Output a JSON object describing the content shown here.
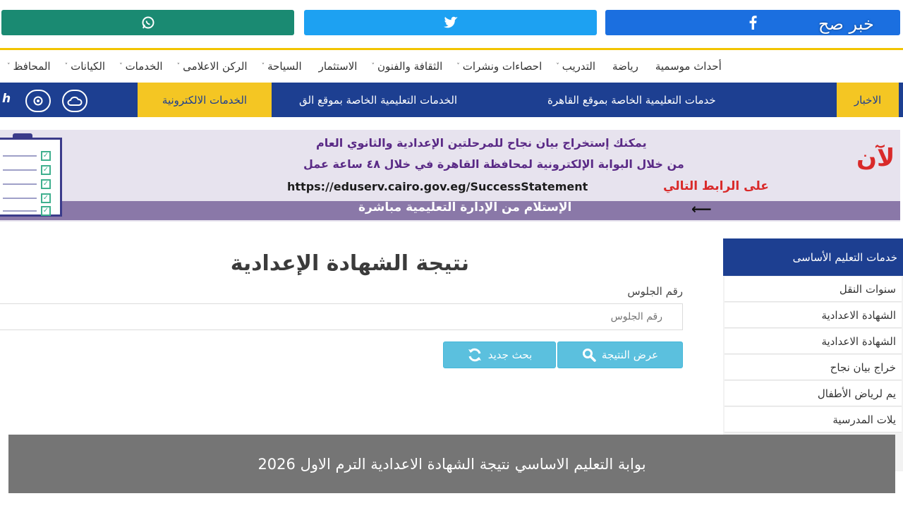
{
  "share": {
    "facebook_icon": "facebook-icon",
    "twitter_icon": "twitter-icon",
    "whatsapp_icon": "whatsapp-icon",
    "brand": "خبر صح"
  },
  "nav": {
    "items": [
      {
        "label": "المحافظ",
        "caret": "˅"
      },
      {
        "label": "الكيانات",
        "caret": "˅"
      },
      {
        "label": "الخدمات",
        "caret": "˅"
      },
      {
        "label": "الركن الاعلامى",
        "caret": "˅"
      },
      {
        "label": "السياحة",
        "caret": "˅"
      },
      {
        "label": "الاستثمار",
        "caret": ""
      },
      {
        "label": "الثقافة والفنون",
        "caret": "˅"
      },
      {
        "label": "احصاءات ونشرات",
        "caret": "˅"
      },
      {
        "label": "التدريب",
        "caret": "˅"
      },
      {
        "label": "رياضة",
        "caret": ""
      },
      {
        "label": "أحداث موسمية",
        "caret": ""
      }
    ]
  },
  "bar": {
    "news": "الاخبار",
    "link_1": "خدمات التعليمية الخاصة بموقع القاهرة",
    "link_2": "الخدمات التعليمية الخاصة بموقع الق",
    "eservices": "الخدمات الالكترونية",
    "h": "h"
  },
  "banner": {
    "line_1": "يمكنك إستخراج بيان نجاح للمرحلتين الإعدادية والثانوي العام",
    "line_2": "من خلال البوابة الإلكترونية لمحافظة القاهرة في خلال ٤٨ ساعة عمل",
    "link_label": "على الرابط التالي",
    "url": "https://eduserv.cairo.gov.eg/SuccessStatement",
    "now": "لآن",
    "bottom": "الإستلام من الإدارة التعليمية مباشرة",
    "arrow": "⟵"
  },
  "form": {
    "title": "نتيجة الشهادة الإعدادية",
    "seat_label": "رقم الجلوس",
    "seat_placeholder": "رقم الجلوس",
    "show_button": "عرض النتيجة",
    "new_button": "بحث جديد"
  },
  "sidebar": {
    "heading": "خدمات التعليم الأساسى",
    "items": [
      "سنوات النقل",
      "الشهادة الاعدادية",
      "الشهادة الاعدادية",
      "خراج بيان نجاح",
      "يم لرياض الأطفال",
      "يلات المدرسية"
    ]
  },
  "caption": "بوابة التعليم الاساسي نتيجة الشهادة الاعدادية الترم الاول 2026",
  "colors": {
    "navy": "#1d3f91",
    "yellow": "#f4c623",
    "button": "#5bc0de",
    "facebook": "#1b6fe0",
    "twitter": "#1da1f2",
    "whatsapp": "#1a8a72"
  }
}
